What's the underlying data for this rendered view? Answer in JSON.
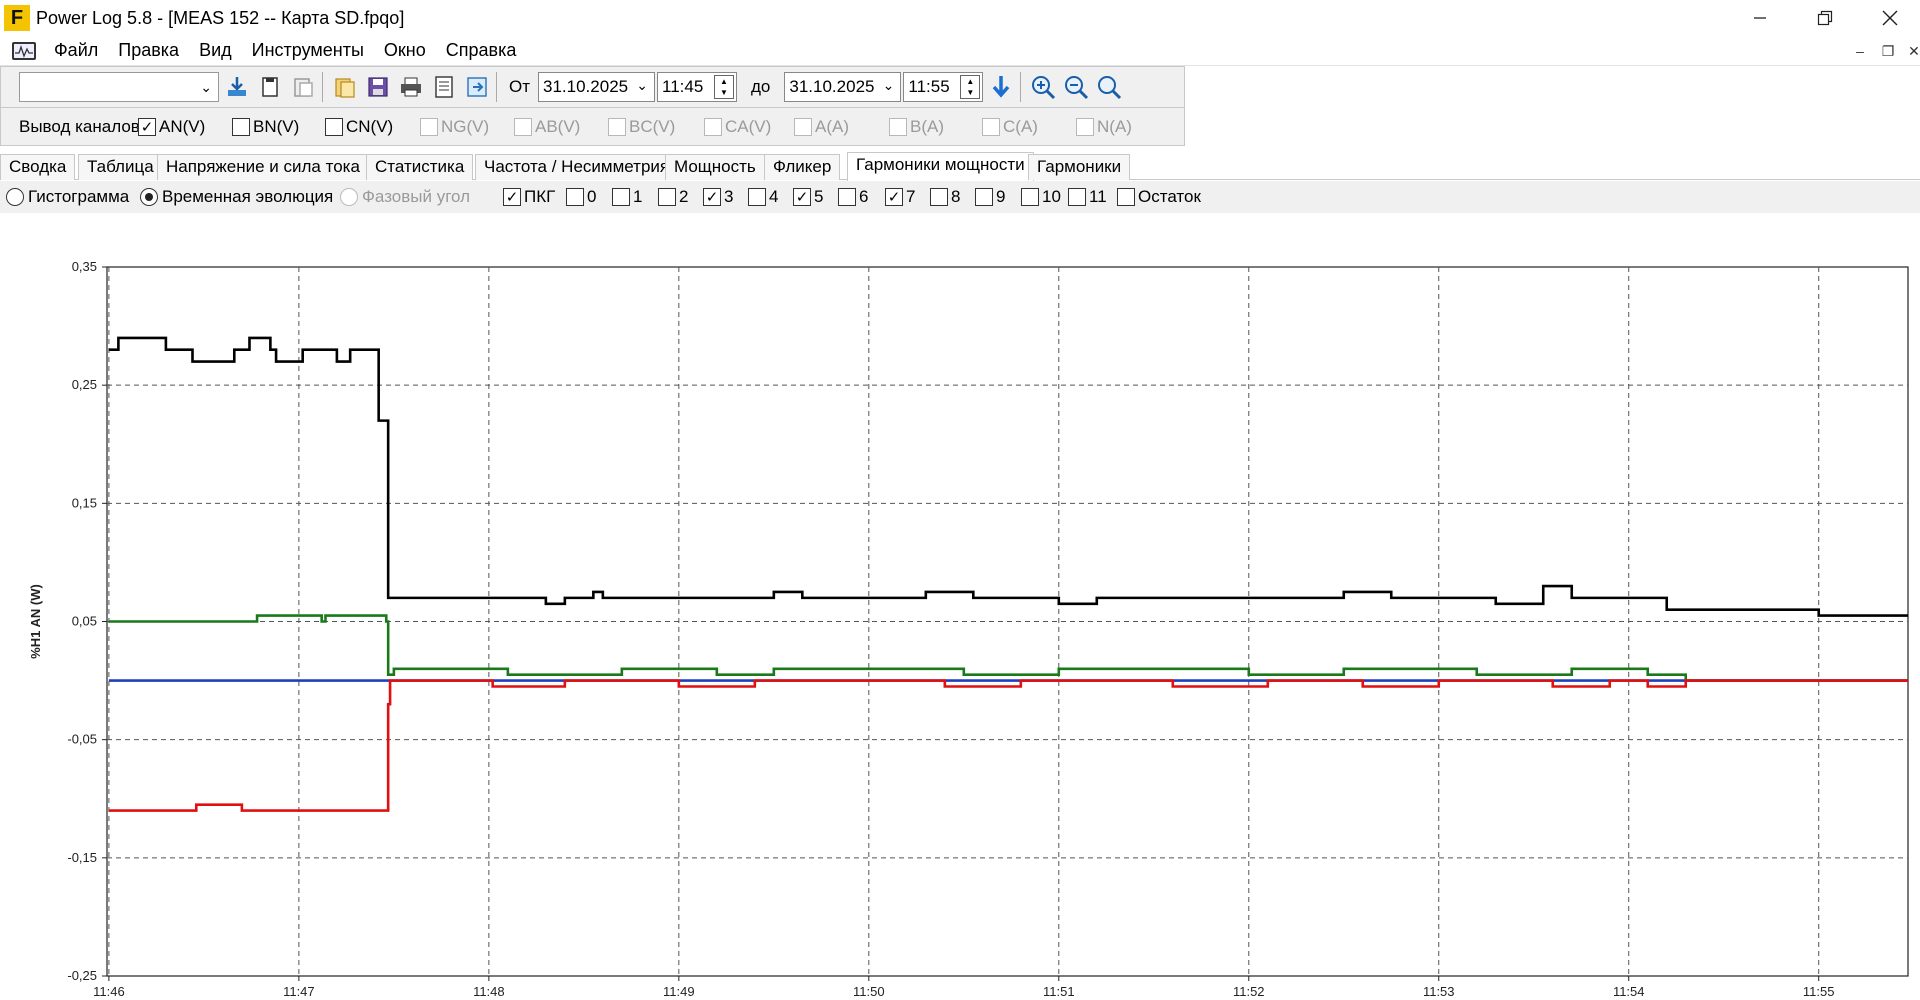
{
  "window": {
    "logo": "F",
    "title": "Power Log 5.8 - [MEAS 152 -- Карта SD.fpqo]"
  },
  "menu": [
    "Файл",
    "Правка",
    "Вид",
    "Инструменты",
    "Окно",
    "Справка"
  ],
  "toolbar": {
    "from_label": "От",
    "from_date": "31.10.2025",
    "from_time": "11:45",
    "to_label": "до",
    "to_date": "31.10.2025",
    "to_time": "11:55"
  },
  "channels": {
    "label": "Вывод каналов",
    "items": [
      {
        "label": "AN(V)",
        "checked": true,
        "enabled": true
      },
      {
        "label": "BN(V)",
        "checked": false,
        "enabled": true
      },
      {
        "label": "CN(V)",
        "checked": false,
        "enabled": true
      },
      {
        "label": "NG(V)",
        "checked": false,
        "enabled": false
      },
      {
        "label": "AB(V)",
        "checked": false,
        "enabled": false
      },
      {
        "label": "BC(V)",
        "checked": false,
        "enabled": false
      },
      {
        "label": "CA(V)",
        "checked": false,
        "enabled": false
      },
      {
        "label": "A(A)",
        "checked": false,
        "enabled": false
      },
      {
        "label": "B(A)",
        "checked": false,
        "enabled": false
      },
      {
        "label": "C(A)",
        "checked": false,
        "enabled": false
      },
      {
        "label": "N(A)",
        "checked": false,
        "enabled": false
      }
    ]
  },
  "tabs": [
    {
      "label": "Сводка"
    },
    {
      "label": "Таблица"
    },
    {
      "label": "Напряжение и сила тока"
    },
    {
      "label": "Статистика"
    },
    {
      "label": "Частота / Несимметрия"
    },
    {
      "label": "Мощность"
    },
    {
      "label": "Фликер"
    },
    {
      "label": "Гармоники мощности",
      "active": true
    },
    {
      "label": "Гармоники"
    }
  ],
  "view_modes": [
    {
      "label": "Гистограмма",
      "selected": false,
      "enabled": true
    },
    {
      "label": "Временная эволюция",
      "selected": true,
      "enabled": true
    },
    {
      "label": "Фазовый угол",
      "selected": false,
      "enabled": false
    }
  ],
  "harmonics": [
    {
      "label": "ПКГ",
      "checked": true
    },
    {
      "label": "0",
      "checked": false
    },
    {
      "label": "1",
      "checked": false
    },
    {
      "label": "2",
      "checked": false
    },
    {
      "label": "3",
      "checked": true
    },
    {
      "label": "4",
      "checked": false
    },
    {
      "label": "5",
      "checked": true
    },
    {
      "label": "6",
      "checked": false
    },
    {
      "label": "7",
      "checked": true
    },
    {
      "label": "8",
      "checked": false
    },
    {
      "label": "9",
      "checked": false
    },
    {
      "label": "10",
      "checked": false
    },
    {
      "label": "11",
      "checked": false
    },
    {
      "label": "Остаток",
      "checked": false
    }
  ],
  "chart_data": {
    "type": "line",
    "ylabel": "%H1 AN (W)",
    "ylim": [
      -0.25,
      0.35
    ],
    "yticks": [
      "0,35",
      "0,25",
      "0,15",
      "0,05",
      "-0,05",
      "-0,15",
      "-0,25"
    ],
    "xticks": [
      "11:46",
      "11:47",
      "11:48",
      "11:49",
      "11:50",
      "11:51",
      "11:52",
      "11:53",
      "11:54",
      "11:55"
    ],
    "xlim_minutes": [
      -0.01,
      9.47
    ],
    "grid": true,
    "series": [
      {
        "color": "#000000",
        "points": [
          [
            0,
            0.28
          ],
          [
            0.05,
            0.29
          ],
          [
            0.3,
            0.28
          ],
          [
            0.44,
            0.27
          ],
          [
            0.66,
            0.28
          ],
          [
            0.74,
            0.29
          ],
          [
            0.85,
            0.28
          ],
          [
            0.88,
            0.27
          ],
          [
            1.02,
            0.28
          ],
          [
            1.2,
            0.27
          ],
          [
            1.27,
            0.28
          ],
          [
            1.4,
            0.28
          ],
          [
            1.42,
            0.22
          ],
          [
            1.45,
            0.22
          ],
          [
            1.47,
            0.07
          ],
          [
            2.2,
            0.07
          ],
          [
            2.3,
            0.065
          ],
          [
            2.4,
            0.07
          ],
          [
            2.55,
            0.075
          ],
          [
            2.6,
            0.07
          ],
          [
            3.5,
            0.07
          ],
          [
            3.5,
            0.075
          ],
          [
            3.65,
            0.07
          ],
          [
            4.3,
            0.075
          ],
          [
            4.55,
            0.07
          ],
          [
            5.0,
            0.065
          ],
          [
            5.2,
            0.07
          ],
          [
            6.5,
            0.07
          ],
          [
            6.5,
            0.075
          ],
          [
            6.75,
            0.07
          ],
          [
            7.0,
            0.07
          ],
          [
            7.3,
            0.065
          ],
          [
            7.55,
            0.08
          ],
          [
            7.7,
            0.07
          ],
          [
            8.2,
            0.07
          ],
          [
            8.2,
            0.06
          ],
          [
            8.5,
            0.06
          ],
          [
            9.0,
            0.055
          ],
          [
            9.47,
            0.055
          ]
        ]
      },
      {
        "color": "#1a7a1a",
        "points": [
          [
            0,
            0.05
          ],
          [
            0.75,
            0.05
          ],
          [
            0.78,
            0.055
          ],
          [
            1.12,
            0.05
          ],
          [
            1.14,
            0.055
          ],
          [
            1.46,
            0.05
          ],
          [
            1.47,
            0.005
          ],
          [
            1.5,
            0.01
          ],
          [
            2.05,
            0.01
          ],
          [
            2.1,
            0.005
          ],
          [
            2.5,
            0.005
          ],
          [
            2.7,
            0.01
          ],
          [
            3.2,
            0.005
          ],
          [
            3.5,
            0.01
          ],
          [
            4.5,
            0.005
          ],
          [
            5.0,
            0.01
          ],
          [
            6.0,
            0.005
          ],
          [
            6.5,
            0.01
          ],
          [
            7.2,
            0.005
          ],
          [
            7.7,
            0.01
          ],
          [
            8.1,
            0.005
          ],
          [
            8.3,
            0.0
          ],
          [
            9.47,
            0.0
          ]
        ]
      },
      {
        "color": "#1f3fbf",
        "points": [
          [
            0,
            0.0
          ],
          [
            1.47,
            0.0
          ],
          [
            9.47,
            0.0
          ]
        ]
      },
      {
        "color": "#e01010",
        "points": [
          [
            0,
            -0.11
          ],
          [
            0.3,
            -0.11
          ],
          [
            0.46,
            -0.105
          ],
          [
            0.7,
            -0.11
          ],
          [
            1.0,
            -0.11
          ],
          [
            1.35,
            -0.11
          ],
          [
            1.47,
            -0.11
          ],
          [
            1.47,
            -0.02
          ],
          [
            1.48,
            0.0
          ],
          [
            2.0,
            0.0
          ],
          [
            2.02,
            -0.005
          ],
          [
            2.4,
            0.0
          ],
          [
            3.0,
            -0.005
          ],
          [
            3.4,
            0.0
          ],
          [
            4.4,
            -0.005
          ],
          [
            4.8,
            0.0
          ],
          [
            5.6,
            -0.005
          ],
          [
            6.1,
            0.0
          ],
          [
            6.6,
            -0.005
          ],
          [
            7.0,
            0.0
          ],
          [
            7.6,
            -0.005
          ],
          [
            7.9,
            0.0
          ],
          [
            8.1,
            -0.005
          ],
          [
            8.3,
            0.0
          ],
          [
            9.47,
            0.0
          ]
        ]
      }
    ]
  },
  "colors": {
    "brand": "#f5c400",
    "series_black": "#000000",
    "series_green": "#1a7a1a",
    "series_blue": "#1f3fbf",
    "series_red": "#e01010",
    "grid": "#555555"
  }
}
